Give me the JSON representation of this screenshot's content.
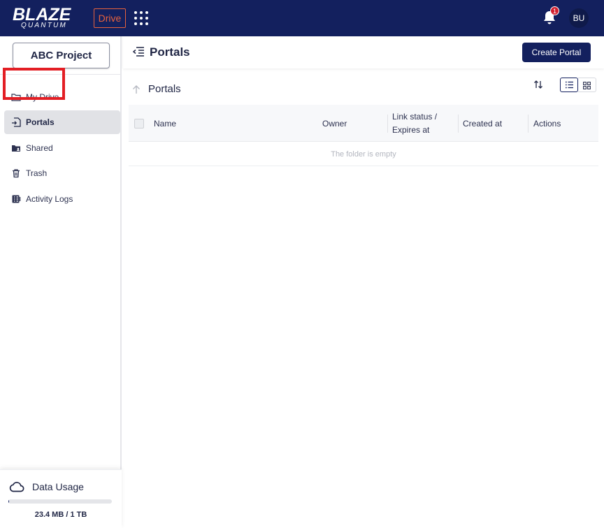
{
  "header": {
    "logo_main": "BLAZE",
    "logo_sub": "QUANTUM",
    "app_badge": "Drive",
    "notification_count": "1",
    "user_initials": "BU"
  },
  "sidebar": {
    "project_button": "ABC Project",
    "items": [
      {
        "label": "My Drive",
        "icon": "folder-icon"
      },
      {
        "label": "Portals",
        "icon": "portal-icon",
        "active": true
      },
      {
        "label": "Shared",
        "icon": "shared-folder-icon"
      },
      {
        "label": "Trash",
        "icon": "trash-icon"
      },
      {
        "label": "Activity Logs",
        "icon": "activity-log-icon"
      }
    ],
    "usage": {
      "title": "Data Usage",
      "amount": "23.4 MB / 1 TB"
    }
  },
  "main": {
    "page_title": "Portals",
    "create_button": "Create Portal",
    "breadcrumb_title": "Portals",
    "table": {
      "columns": [
        "Name",
        "Owner",
        "Link status / Expires at",
        "Created at",
        "Actions"
      ],
      "empty_message": "The folder is empty"
    }
  },
  "colors": {
    "navy": "#13205e",
    "accent_orange": "#e8623d",
    "badge_red": "#d2202f",
    "highlight_red": "#e31e24"
  }
}
